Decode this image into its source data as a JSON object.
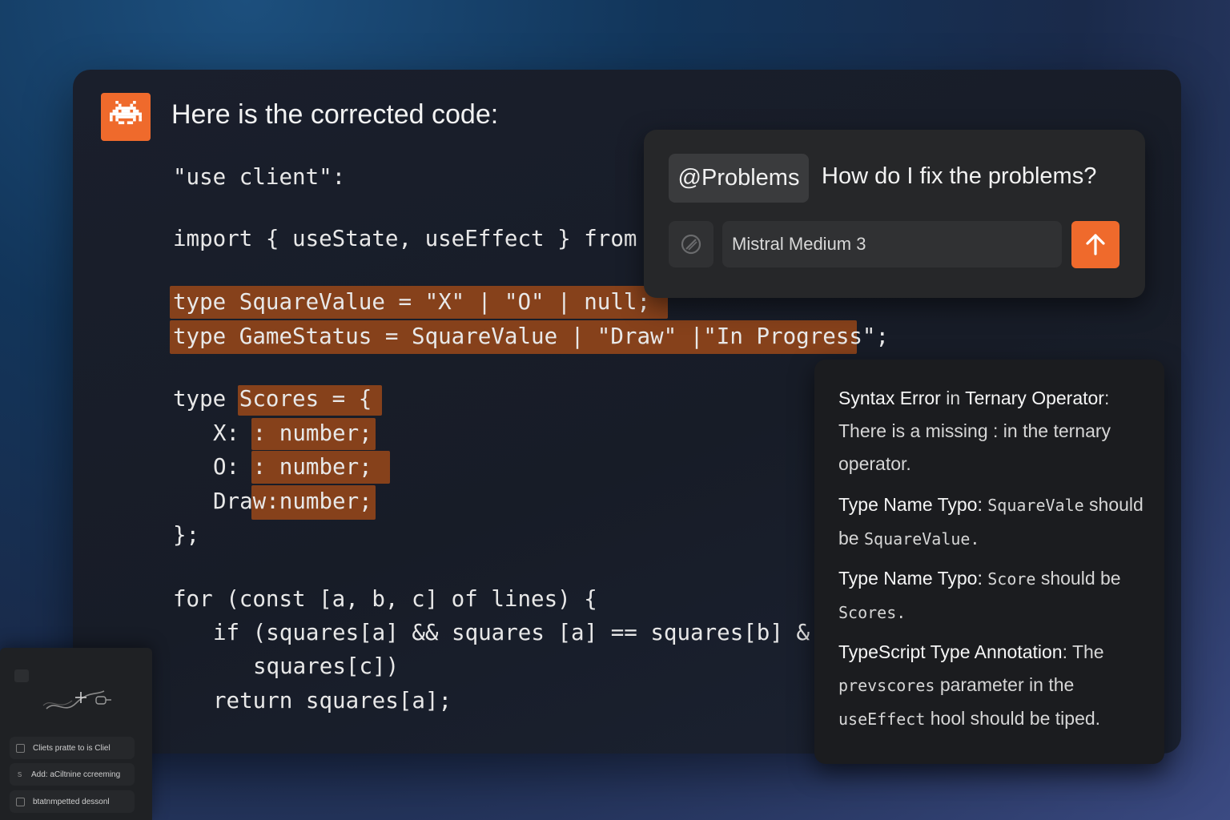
{
  "assistant": {
    "avatar_icon": "space-invader-icon",
    "heading": "Here is the corrected code:"
  },
  "code_lines": [
    "\"use client\":",
    "import { useState, useEffect } from",
    "type SquareValue = \"X\" | \"O\" | null;",
    "type GameStatus = SquareValue | \"Draw\" |\"In Progress\";",
    "type Scores = {",
    "X: : number;",
    "O: : number;",
    "Draw:number;",
    "};",
    "for (const [a, b, c] of lines) {",
    "if (squares[a] && squares [a] == squares[b] &",
    "squares[c])",
    "return squares[a];"
  ],
  "chat": {
    "mention": "@Problems",
    "question": "How do I fix the problems?",
    "model": "Mistral Medium 3",
    "attach_icon": "attach-disabled-icon",
    "send_icon": "arrow-up-icon"
  },
  "problems": [
    {
      "title": "Syntax Error",
      "mid": " in ",
      "title2": "Ternary Operator",
      "suffix": ":",
      "body": "There is a missing : in the ternary operator."
    },
    {
      "title": "Type Name Typo:",
      "code1": "SquareVale",
      "text": "should be",
      "code2": "SquareValue."
    },
    {
      "title": "Type Name Typo:",
      "code1": "Score",
      "text": "should be",
      "code2": "Scores."
    },
    {
      "title": "TypeScript Type Annotation",
      "suffix": ": The",
      "code1": "prevscores",
      "text": "parameter in the",
      "code2": "useEffect",
      "text2": "hool should be tiped."
    }
  ],
  "mini_panel": {
    "items": [
      "Cliets pratte to is  Cliel",
      "Add: aCiltnine ccreeming",
      "btatnmpetted dessonl"
    ]
  },
  "colors": {
    "accent": "#ef6a2c",
    "highlight": "#86411b",
    "keyword": "#f3cc59"
  }
}
